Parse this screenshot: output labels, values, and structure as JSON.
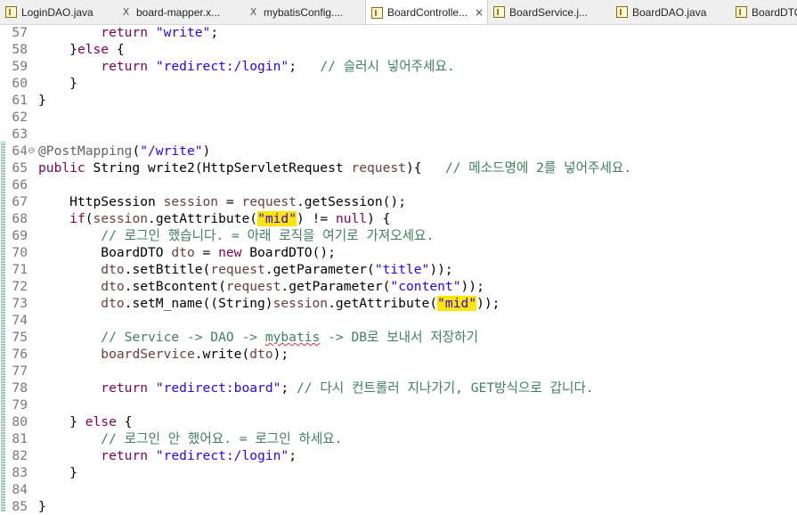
{
  "tabs": [
    {
      "label": "LoginDAO.java",
      "icon": "java-file-icon"
    },
    {
      "label": "board-mapper.x...",
      "icon": "xml-file-icon"
    },
    {
      "label": "mybatisConfig....",
      "icon": "xml-file-icon"
    },
    {
      "label": "BoardControlle...",
      "icon": "java-file-icon",
      "active": true,
      "close": "×"
    },
    {
      "label": "BoardService.j...",
      "icon": "java-file-icon"
    },
    {
      "label": "BoardDAO.java",
      "icon": "java-file-icon"
    },
    {
      "label": "BoardDTO",
      "icon": "java-file-icon"
    }
  ],
  "lines": [
    {
      "n": "57",
      "t": [
        [
          "        ",
          ""
        ],
        [
          "return",
          "kw"
        ],
        [
          " ",
          ""
        ],
        [
          "\"write\"",
          "str"
        ],
        [
          ";",
          ""
        ]
      ]
    },
    {
      "n": "58",
      "t": [
        [
          "    }",
          ""
        ],
        [
          "else",
          "kw"
        ],
        [
          " {",
          ""
        ]
      ]
    },
    {
      "n": "59",
      "t": [
        [
          "        ",
          ""
        ],
        [
          "return",
          "kw"
        ],
        [
          " ",
          ""
        ],
        [
          "\"redirect:/login\"",
          "str"
        ],
        [
          ";   ",
          ""
        ],
        [
          "// 슬러시 넣어주세요.",
          "cm"
        ]
      ]
    },
    {
      "n": "60",
      "t": [
        [
          "    }",
          ""
        ]
      ]
    },
    {
      "n": "61",
      "t": [
        [
          "}",
          ""
        ]
      ]
    },
    {
      "n": "62",
      "t": []
    },
    {
      "n": "63",
      "t": []
    },
    {
      "n": "64",
      "fold": "⊖",
      "t": [
        [
          "@PostMapping",
          "ann"
        ],
        [
          "(",
          ""
        ],
        [
          "\"/write\"",
          "str"
        ],
        [
          ")",
          ""
        ]
      ]
    },
    {
      "n": "65",
      "t": [
        [
          "public",
          "kw"
        ],
        [
          " String write2(HttpServletRequest ",
          ""
        ],
        [
          "request",
          "var"
        ],
        [
          "){   ",
          ""
        ],
        [
          "// 메소드명에 2를 넣어주세요.",
          "cm"
        ]
      ]
    },
    {
      "n": "66",
      "t": []
    },
    {
      "n": "67",
      "t": [
        [
          "    HttpSession ",
          ""
        ],
        [
          "session",
          "var"
        ],
        [
          " = ",
          ""
        ],
        [
          "request",
          "var"
        ],
        [
          ".getSession();",
          ""
        ]
      ]
    },
    {
      "n": "68",
      "t": [
        [
          "    ",
          ""
        ],
        [
          "if",
          "kw"
        ],
        [
          "(",
          ""
        ],
        [
          "session",
          "var"
        ],
        [
          ".getAttribute(",
          ""
        ],
        [
          "\"mid\"",
          "str hl"
        ],
        [
          ") != ",
          ""
        ],
        [
          "null",
          "kw"
        ],
        [
          ") {",
          ""
        ]
      ]
    },
    {
      "n": "69",
      "t": [
        [
          "        ",
          ""
        ],
        [
          "// 로그인 했습니다. = 아래 로직을 여기로 가져오세요.",
          "cm"
        ]
      ]
    },
    {
      "n": "70",
      "t": [
        [
          "        BoardDTO ",
          ""
        ],
        [
          "dto",
          "var"
        ],
        [
          " = ",
          ""
        ],
        [
          "new",
          "kw"
        ],
        [
          " BoardDTO();",
          ""
        ]
      ]
    },
    {
      "n": "71",
      "t": [
        [
          "        ",
          ""
        ],
        [
          "dto",
          "var"
        ],
        [
          ".setBtitle(",
          ""
        ],
        [
          "request",
          "var"
        ],
        [
          ".getParameter(",
          ""
        ],
        [
          "\"title\"",
          "str"
        ],
        [
          "));",
          ""
        ]
      ]
    },
    {
      "n": "72",
      "t": [
        [
          "        ",
          ""
        ],
        [
          "dto",
          "var"
        ],
        [
          ".setBcontent(",
          ""
        ],
        [
          "request",
          "var"
        ],
        [
          ".getParameter(",
          ""
        ],
        [
          "\"content\"",
          "str"
        ],
        [
          "));",
          ""
        ]
      ]
    },
    {
      "n": "73",
      "t": [
        [
          "        ",
          ""
        ],
        [
          "dto",
          "var"
        ],
        [
          ".setM_name((String)",
          ""
        ],
        [
          "session",
          "var"
        ],
        [
          ".getAttribute(",
          ""
        ],
        [
          "\"mid\"",
          "str hl"
        ],
        [
          "));",
          ""
        ]
      ]
    },
    {
      "n": "74",
      "t": []
    },
    {
      "n": "75",
      "t": [
        [
          "        ",
          ""
        ],
        [
          "// Service -> DAO -> ",
          "cm"
        ],
        [
          "mybatis",
          "cm squig"
        ],
        [
          " -> DB로 보내서 저장하기",
          "cm"
        ]
      ]
    },
    {
      "n": "76",
      "t": [
        [
          "        ",
          ""
        ],
        [
          "boardService",
          "var"
        ],
        [
          ".write(",
          ""
        ],
        [
          "dto",
          "var"
        ],
        [
          ");",
          ""
        ]
      ]
    },
    {
      "n": "77",
      "t": []
    },
    {
      "n": "78",
      "t": [
        [
          "        ",
          ""
        ],
        [
          "return",
          "kw"
        ],
        [
          " ",
          ""
        ],
        [
          "\"redirect:board\"",
          "str"
        ],
        [
          "; ",
          ""
        ],
        [
          "// 다시 컨트롤러 지나가기, GET방식으로 갑니다.",
          "cm"
        ]
      ]
    },
    {
      "n": "79",
      "t": []
    },
    {
      "n": "80",
      "t": [
        [
          "    } ",
          ""
        ],
        [
          "else",
          "kw"
        ],
        [
          " {",
          ""
        ]
      ]
    },
    {
      "n": "81",
      "t": [
        [
          "        ",
          ""
        ],
        [
          "// 로그인 안 했어요. = 로그인 하세요.",
          "cm"
        ]
      ]
    },
    {
      "n": "82",
      "t": [
        [
          "        ",
          ""
        ],
        [
          "return",
          "kw"
        ],
        [
          " ",
          ""
        ],
        [
          "\"redirect:/login\"",
          "str"
        ],
        [
          ";",
          ""
        ]
      ]
    },
    {
      "n": "83",
      "t": [
        [
          "    }",
          ""
        ]
      ]
    },
    {
      "n": "84",
      "t": []
    },
    {
      "n": "85",
      "t": [
        [
          "}",
          ""
        ]
      ]
    }
  ]
}
